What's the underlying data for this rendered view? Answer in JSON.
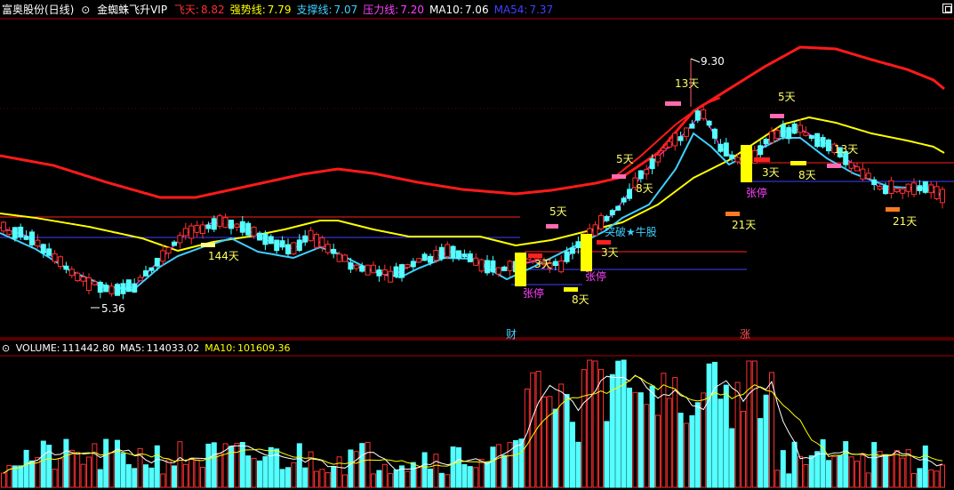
{
  "header": {
    "stock": "富奥股份(日线)",
    "indicator": "金蜘蛛飞升VIP",
    "items": [
      {
        "label": "飞天:",
        "value": "8.82",
        "lc": "#ff3030",
        "vc": "#ff3030"
      },
      {
        "label": "强势线:",
        "value": "7.79",
        "lc": "#ffff00",
        "vc": "#ffff00"
      },
      {
        "label": "支撑线:",
        "value": "7.07",
        "lc": "#3fd0ff",
        "vc": "#3fd0ff"
      },
      {
        "label": "压力线:",
        "value": "7.20",
        "lc": "#ff40ff",
        "vc": "#ff40ff"
      },
      {
        "label": "MA10:",
        "value": "7.06",
        "lc": "#ffffff",
        "vc": "#ffffff"
      },
      {
        "label": "MA54:",
        "value": "7.37",
        "lc": "#4040ff",
        "vc": "#4040ff"
      }
    ]
  },
  "volume_header": {
    "items": [
      {
        "label": "VOLUME:",
        "value": "111442.80",
        "color": "#ffffff"
      },
      {
        "label": "MA5:",
        "value": "114033.02",
        "color": "#ffffff"
      },
      {
        "label": "MA10:",
        "value": "101609.36",
        "color": "#ffff00"
      }
    ]
  },
  "annotations": [
    {
      "text": "9.30",
      "color": "#ffffff"
    },
    {
      "text": "5.36",
      "color": "#ffffff"
    },
    {
      "text": "144天",
      "color": "#ffff66"
    },
    {
      "text": "5天",
      "color": "#ffff66"
    },
    {
      "text": "3天",
      "color": "#ffff66"
    },
    {
      "text": "8天",
      "color": "#ffff66"
    },
    {
      "text": "张停",
      "color": "#ff40ff"
    },
    {
      "text": "张停",
      "color": "#ff40ff"
    },
    {
      "text": "3天",
      "color": "#ffff66"
    },
    {
      "text": "突破★牛股",
      "color": "#3fd0ff"
    },
    {
      "text": "5天",
      "color": "#ffff66"
    },
    {
      "text": "8天",
      "color": "#ffff66"
    },
    {
      "text": "13天",
      "color": "#ffff66"
    },
    {
      "text": "5天",
      "color": "#ffff66"
    },
    {
      "text": "3天",
      "color": "#ffff66"
    },
    {
      "text": "8天",
      "color": "#ffff66"
    },
    {
      "text": "13天",
      "color": "#ffff66"
    },
    {
      "text": "张停",
      "color": "#ff40ff"
    },
    {
      "text": "21天",
      "color": "#ffff66"
    },
    {
      "text": "21天",
      "color": "#ffff66"
    }
  ],
  "event_markers": [
    {
      "text": "财",
      "color": "#3fd0ff"
    },
    {
      "text": "涨",
      "color": "#ff5050"
    }
  ],
  "colors": {
    "up": "#ff3030",
    "down": "#54ffff",
    "flyline": "#ff1a1a",
    "strong": "#ffff00",
    "support": "#3fd0ff",
    "pressure": "#ff40ff",
    "ma54": "#4040ff",
    "grid": "#b00000",
    "hline_red": "#ff2020",
    "hline_blue": "#4040ff"
  }
}
